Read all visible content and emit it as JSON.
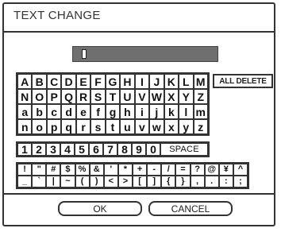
{
  "window": {
    "title": "TEXT CHANGE"
  },
  "input": {
    "value": ""
  },
  "keyboard": {
    "letter_rows": [
      [
        "A",
        "B",
        "C",
        "D",
        "E",
        "F",
        "G",
        "H",
        "I",
        "J",
        "K",
        "L",
        "M"
      ],
      [
        "N",
        "O",
        "P",
        "Q",
        "R",
        "S",
        "T",
        "U",
        "V",
        "W",
        "X",
        "Y",
        "Z"
      ],
      [
        "a",
        "b",
        "c",
        "d",
        "e",
        "f",
        "g",
        "h",
        "i",
        "j",
        "k",
        "l",
        "m"
      ],
      [
        "n",
        "o",
        "p",
        "q",
        "r",
        "s",
        "t",
        "u",
        "v",
        "w",
        "x",
        "y",
        "z"
      ]
    ],
    "digits": [
      "1",
      "2",
      "3",
      "4",
      "5",
      "6",
      "7",
      "8",
      "9",
      "0"
    ],
    "space_label": "SPACE",
    "symbol_rows": [
      [
        "!",
        "\"",
        "#",
        "$",
        "%",
        "&",
        "'",
        "*",
        "+",
        "-",
        "/",
        "=",
        "?",
        "@",
        "¥",
        "^"
      ],
      [
        "_",
        "`",
        "|",
        "~",
        "(",
        ")",
        "<",
        ">",
        "[",
        "]",
        "{",
        "}",
        ",",
        ".",
        ":",
        ";"
      ]
    ],
    "all_delete_label": "ALL DELETE"
  },
  "buttons": {
    "ok_label": "OK",
    "cancel_label": "CANCEL"
  }
}
